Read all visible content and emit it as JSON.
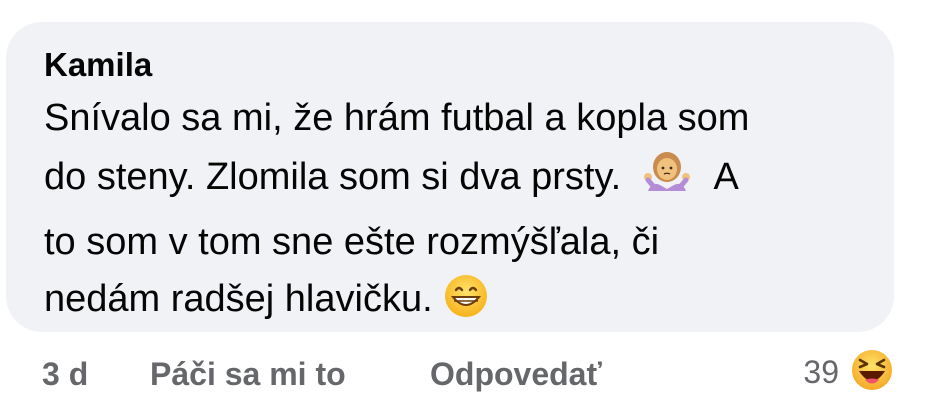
{
  "comment": {
    "author": "Kamila",
    "lines": [
      "Snívalo sa mi, že hrám futbal a kopla som",
      "do steny. Zlomila som si dva prsty.",
      "A",
      "to som v tom sne ešte rozmýšľala, či",
      "nedám radšej hlavičku."
    ],
    "emojis": [
      "woman-shrugging-icon",
      "grinning-face-icon"
    ]
  },
  "footer": {
    "time": "3 d",
    "like_label": "Páči sa mi to",
    "reply_label": "Odpovedať",
    "reaction_count": "39",
    "reaction_icon": "laughing-face-icon"
  },
  "colors": {
    "bubble_bg": "#f0f2f5",
    "text": "#050505",
    "secondary_text": "#65676b"
  }
}
